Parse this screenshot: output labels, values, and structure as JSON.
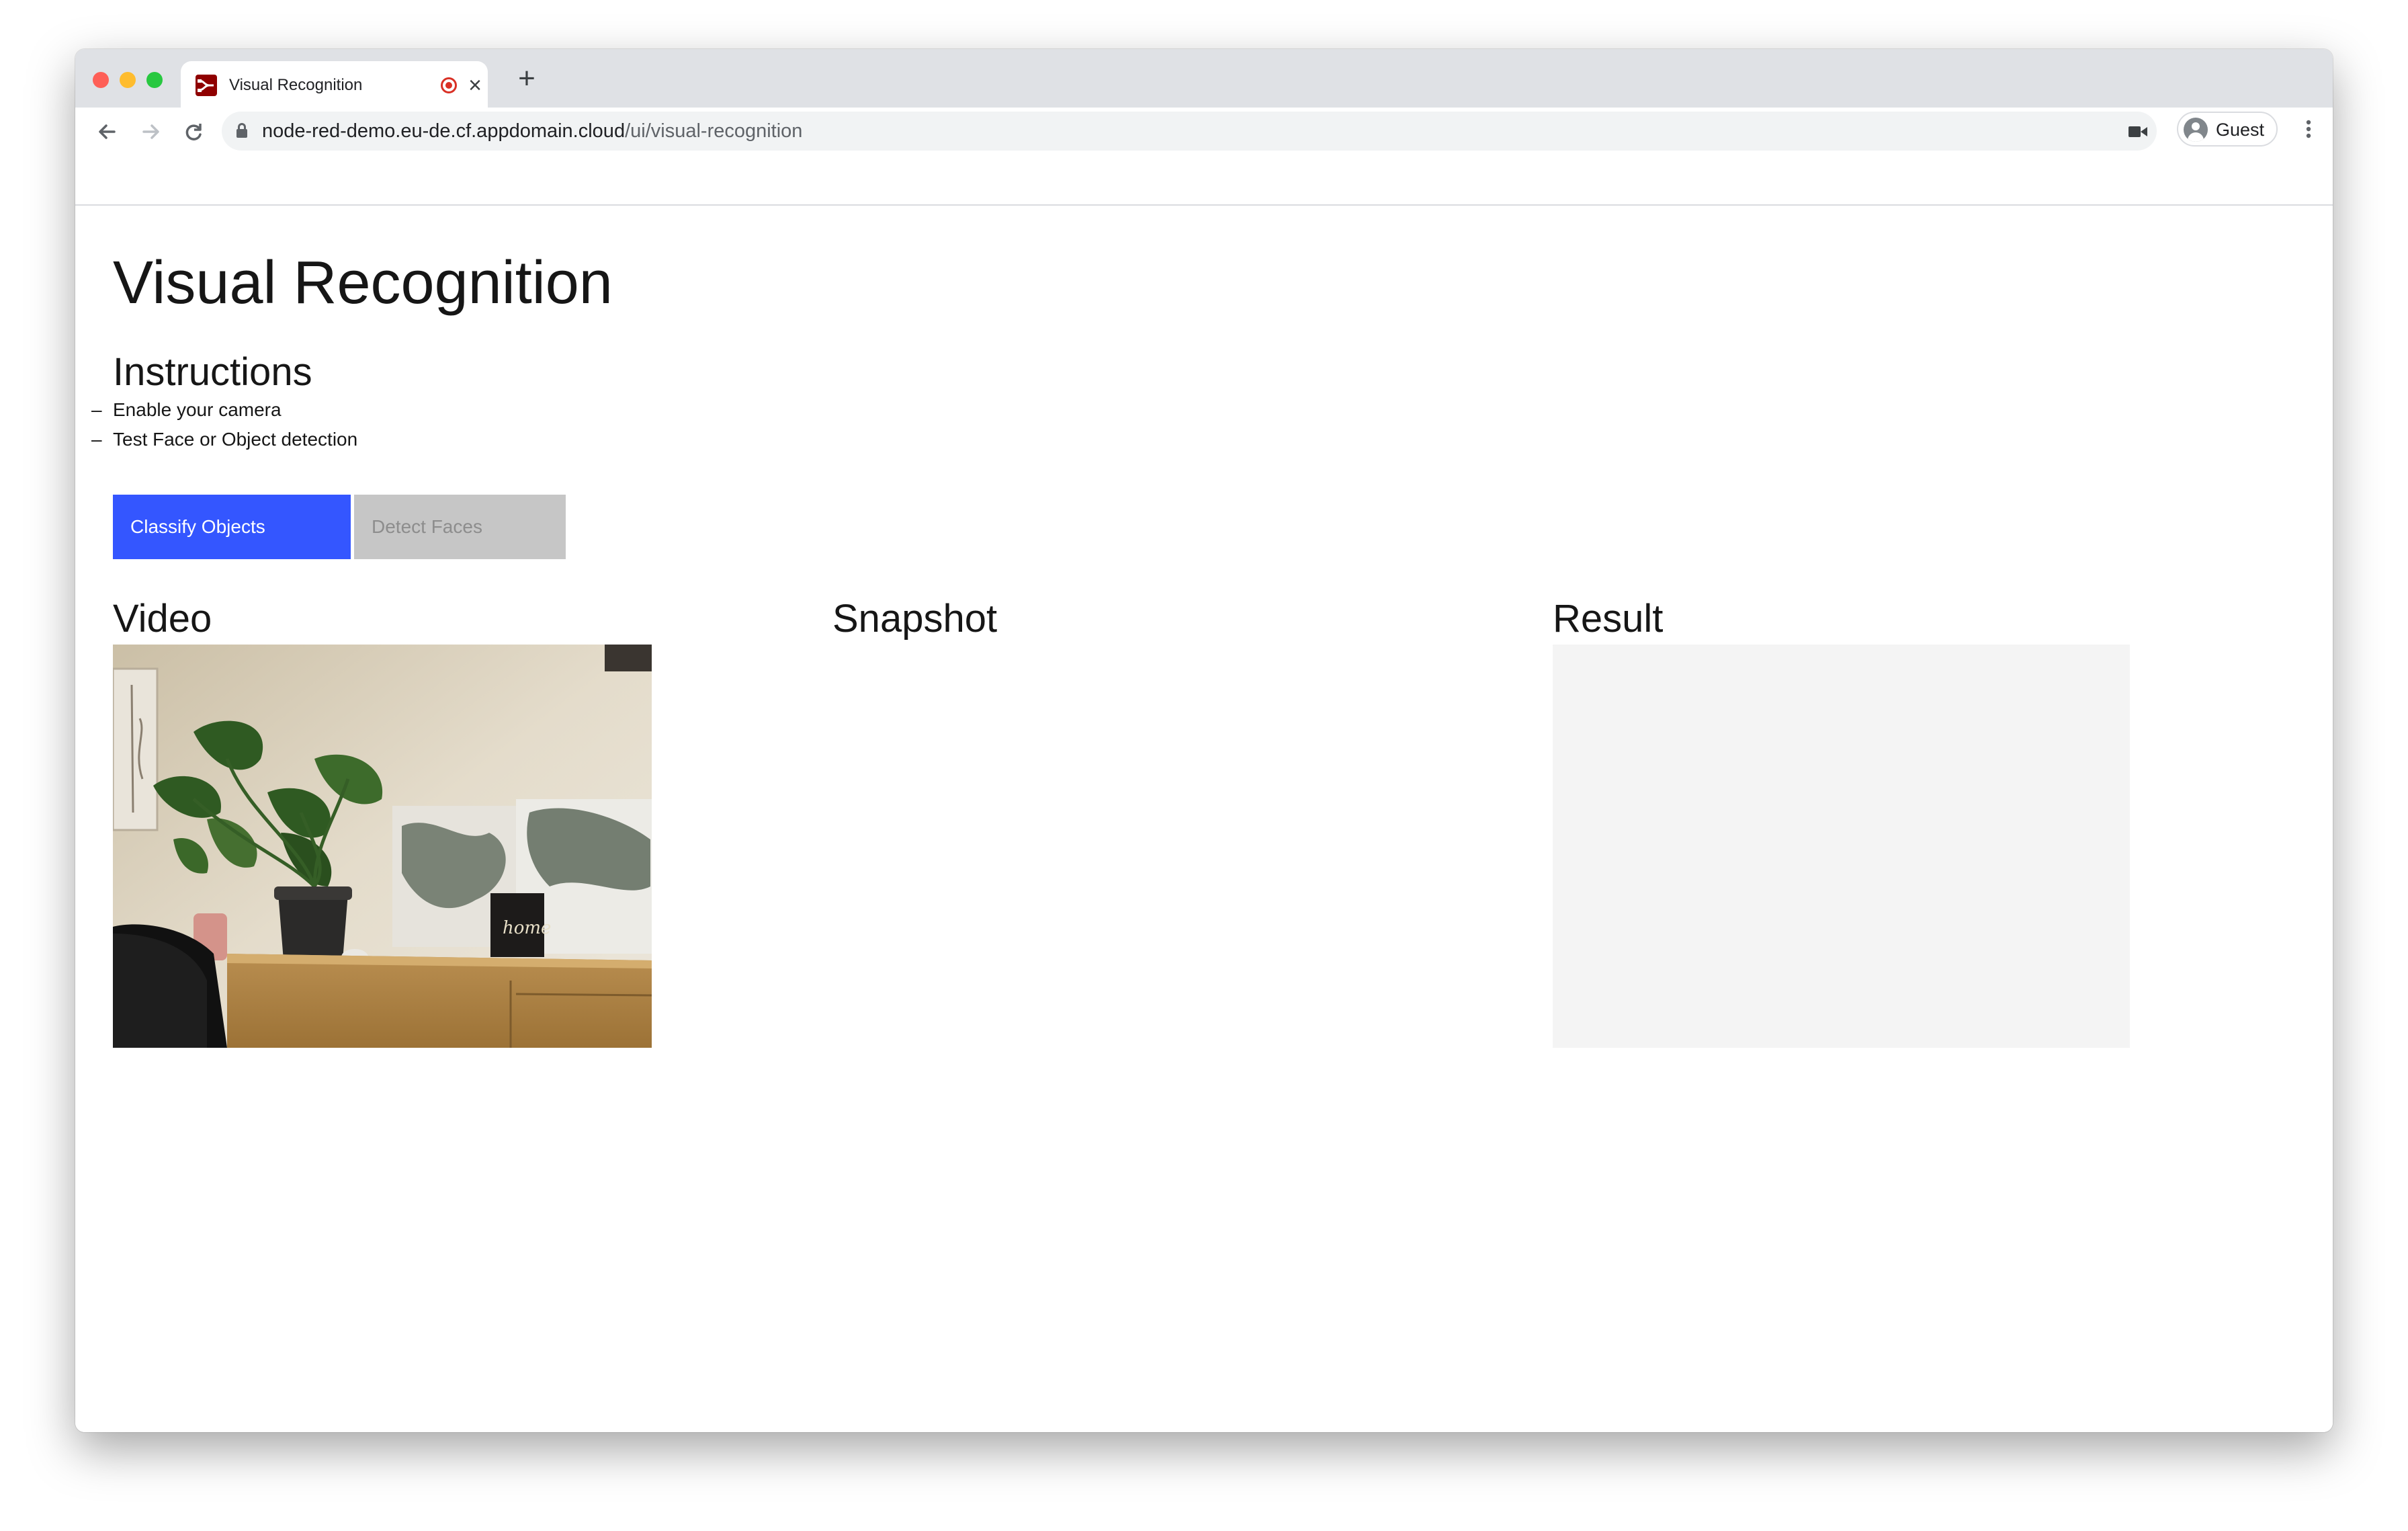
{
  "browser": {
    "tab_title": "Visual Recognition",
    "new_tab_label": "+",
    "close_tab_label": "×",
    "url_host": "node-red-demo.eu-de.cf.appdomain.cloud",
    "url_path": "/ui/visual-recognition",
    "profile_label": "Guest",
    "icons": [
      "back-arrow-icon",
      "forward-arrow-icon",
      "reload-icon",
      "lock-icon",
      "camera-icon",
      "avatar-icon",
      "kebab-menu-icon",
      "recording-icon",
      "close-icon",
      "node-red-favicon"
    ]
  },
  "page": {
    "title": "Visual Recognition",
    "instructions": {
      "heading": "Instructions",
      "items": [
        {
          "bullet": "–",
          "text": "Enable your camera"
        },
        {
          "bullet": "–",
          "text": "Test Face or Object detection"
        }
      ]
    },
    "buttons": {
      "classify": "Classify Objects",
      "detect": "Detect Faces"
    },
    "sections": {
      "video": "Video",
      "snapshot": "Snapshot",
      "result": "Result"
    },
    "video_sign_text": "home"
  },
  "colors": {
    "primary_button": "#3456ff",
    "disabled_button": "#c6c6c6",
    "result_panel": "#f4f4f4",
    "record_indicator": "#d93025"
  }
}
